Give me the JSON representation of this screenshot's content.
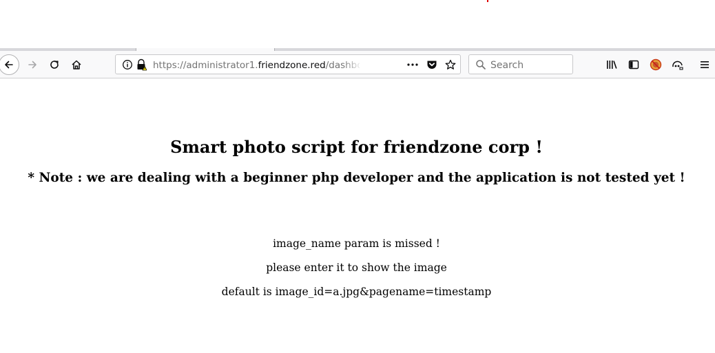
{
  "browser": {
    "url": {
      "prefix": "https://administrator1.",
      "domain": "friendzone.red",
      "path": "/dashboard.ph"
    },
    "search_placeholder": "Search",
    "icons": {
      "back": "back-arrow-icon",
      "forward": "forward-arrow-icon",
      "reload": "reload-icon",
      "home": "home-icon",
      "info": "info-icon",
      "lock": "insecure-lock-icon",
      "page_actions": "more-dots-icon",
      "pocket": "pocket-icon",
      "bookmark": "star-icon",
      "search": "search-icon",
      "library": "library-icon",
      "sidebar": "sidebar-icon",
      "addon": "addon-icon",
      "extension": "extension-icon",
      "menu": "hamburger-menu-icon"
    }
  },
  "page": {
    "title": "Smart photo script for friendzone corp !",
    "note": "* Note : we are dealing with a beginner php developer and the application is not tested yet !",
    "messages": [
      "image_name param is missed !",
      "please enter it to show the image",
      "default is image_id=a.jpg&pagename=timestamp"
    ]
  }
}
